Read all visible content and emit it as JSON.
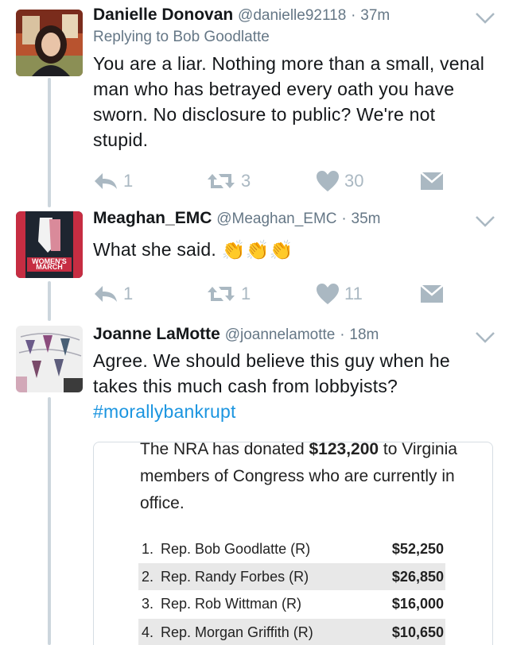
{
  "tweets": [
    {
      "name": "Danielle Donovan",
      "handle": "@danielle92118",
      "dot": "·",
      "time": "37m",
      "replying": "Replying to Bob Goodlatte",
      "text": "You are a liar. Nothing more than a small, venal man who has betrayed every oath you have sworn. No disclosure to public? We're not stupid.",
      "reply_count": "1",
      "retweet_count": "3",
      "like_count": "30"
    },
    {
      "name": "Meaghan_EMC",
      "handle": "@Meaghan_EMC",
      "dot": "·",
      "time": "35m",
      "text": "What she said.",
      "reply_count": "1",
      "retweet_count": "1",
      "like_count": "11",
      "avatar_text": "WOMEN'S MARCH"
    },
    {
      "name": "Joanne LaMotte",
      "handle": "@joannelamotte",
      "dot": "·",
      "time": "18m",
      "text": "Agree. We should believe this guy when he takes this much cash from lobbyists?",
      "hashtag": "#morallybankrupt"
    }
  ],
  "card": {
    "headline_pre": "The NRA has donated ",
    "headline_amount": "$123,200",
    "headline_post": " to Virginia members of Congress who are currently in office.",
    "rows": [
      {
        "num": "1.",
        "rep": "Rep. Bob Goodlatte (R)",
        "amount": "$52,250"
      },
      {
        "num": "2.",
        "rep": "Rep. Randy Forbes (R)",
        "amount": "$26,850"
      },
      {
        "num": "3.",
        "rep": "Rep. Rob Wittman (R)",
        "amount": "$16,000"
      },
      {
        "num": "4.",
        "rep": "Rep. Morgan Griffith (R)",
        "amount": "$10,650"
      }
    ]
  },
  "colors": {
    "secondary_text": "#657786",
    "icon_gray": "#aab8c2",
    "link": "#1b95e0",
    "thread_line": "#ccd6dd"
  },
  "icons": [
    "chevron-down-icon",
    "reply-icon",
    "retweet-icon",
    "like-icon",
    "direct-message-icon",
    "clapping-hands-icon"
  ]
}
